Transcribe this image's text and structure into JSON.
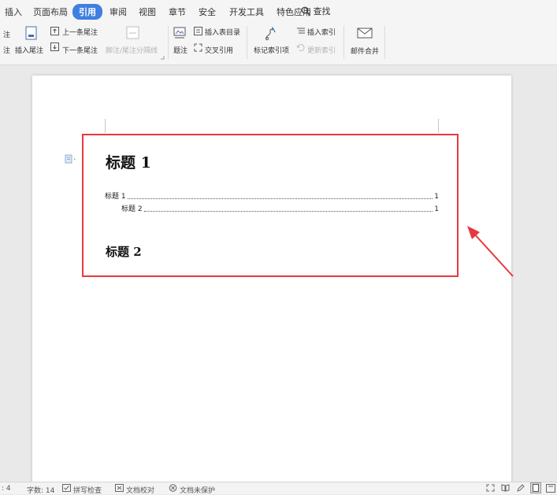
{
  "menu": {
    "items": [
      "插入",
      "页面布局",
      "引用",
      "审阅",
      "视图",
      "章节",
      "安全",
      "开发工具",
      "特色应用"
    ],
    "active": "引用",
    "search_label": "查找"
  },
  "ribbon": {
    "partial_left_1": "注",
    "partial_left_2": "注",
    "insert_endnote": "插入尾注",
    "prev_endnote": "上一条尾注",
    "next_endnote": "下一条尾注",
    "footnote_separator": "脚注/尾注分隔线",
    "caption": "题注",
    "insert_table_of_figures": "插入表目录",
    "cross_reference": "交叉引用",
    "mark_index_entry": "标记索引项",
    "insert_index": "插入索引",
    "update_index": "更新索引",
    "mail_merge": "邮件合并"
  },
  "document": {
    "heading1": "标题 1",
    "toc": [
      {
        "text": "标题 1",
        "page": "1"
      },
      {
        "text": "标题 2",
        "page": "1"
      }
    ],
    "heading2": "标题 2"
  },
  "status": {
    "page_partial": ": 4",
    "word_count": "字数: 14",
    "spell_check": "拼写检查",
    "doc_proofread": "文档校对",
    "doc_unprotected": "文档未保护"
  },
  "colors": {
    "accent": "#3f7fe0",
    "highlight_border": "#e8383d",
    "arrow": "#e8383d"
  }
}
